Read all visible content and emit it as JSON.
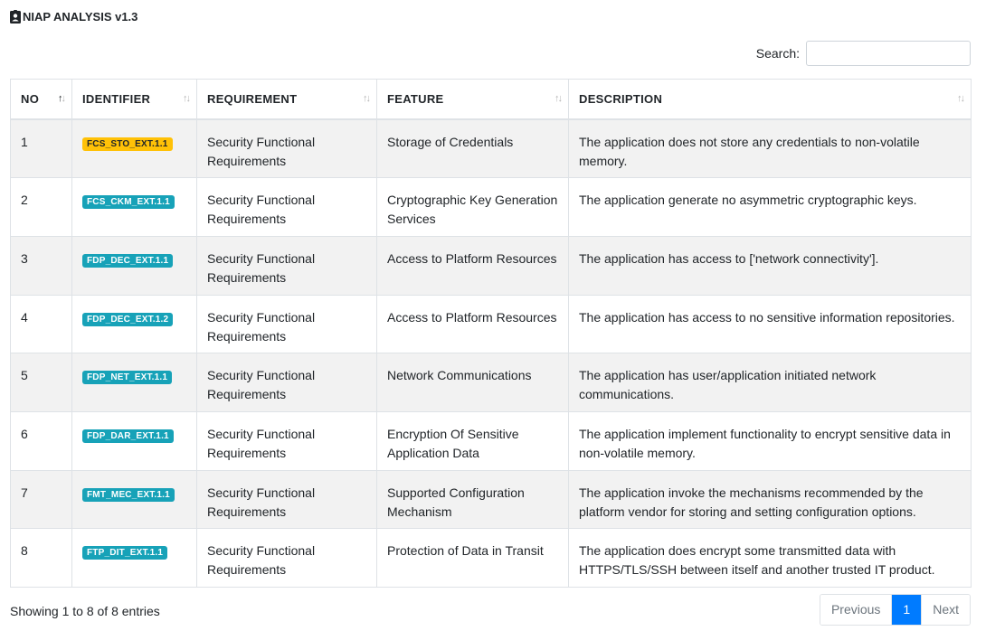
{
  "app": {
    "title": "NIAP ANALYSIS v1.3"
  },
  "search": {
    "label": "Search:",
    "value": "",
    "placeholder": ""
  },
  "table": {
    "columns": [
      "NO",
      "IDENTIFIER",
      "REQUIREMENT",
      "FEATURE",
      "DESCRIPTION"
    ],
    "sorted_column": "NO",
    "rows": [
      {
        "no": "1",
        "identifier": "FCS_STO_EXT.1.1",
        "badge": "warning",
        "requirement": "Security Functional Requirements",
        "feature": "Storage of Credentials",
        "description": "The application does not store any credentials to non-volatile memory."
      },
      {
        "no": "2",
        "identifier": "FCS_CKM_EXT.1.1",
        "badge": "info",
        "requirement": "Security Functional Requirements",
        "feature": "Cryptographic Key Generation Services",
        "description": "The application generate no asymmetric cryptographic keys."
      },
      {
        "no": "3",
        "identifier": "FDP_DEC_EXT.1.1",
        "badge": "info",
        "requirement": "Security Functional Requirements",
        "feature": "Access to Platform Resources",
        "description": "The application has access to ['network connectivity']."
      },
      {
        "no": "4",
        "identifier": "FDP_DEC_EXT.1.2",
        "badge": "info",
        "requirement": "Security Functional Requirements",
        "feature": "Access to Platform Resources",
        "description": "The application has access to no sensitive information repositories."
      },
      {
        "no": "5",
        "identifier": "FDP_NET_EXT.1.1",
        "badge": "info",
        "requirement": "Security Functional Requirements",
        "feature": "Network Communications",
        "description": "The application has user/application initiated network communications."
      },
      {
        "no": "6",
        "identifier": "FDP_DAR_EXT.1.1",
        "badge": "info",
        "requirement": "Security Functional Requirements",
        "feature": "Encryption Of Sensitive Application Data",
        "description": "The application implement functionality to encrypt sensitive data in non-volatile memory."
      },
      {
        "no": "7",
        "identifier": "FMT_MEC_EXT.1.1",
        "badge": "info",
        "requirement": "Security Functional Requirements",
        "feature": "Supported Configuration Mechanism",
        "description": "The application invoke the mechanisms recommended by the platform vendor for storing and setting configuration options."
      },
      {
        "no": "8",
        "identifier": "FTP_DIT_EXT.1.1",
        "badge": "info",
        "requirement": "Security Functional Requirements",
        "feature": "Protection of Data in Transit",
        "description": "The application does encrypt some transmitted data with HTTPS/TLS/SSH between itself and another trusted IT product."
      }
    ]
  },
  "footer": {
    "info": "Showing 1 to 8 of 8 entries",
    "previous": "Previous",
    "current_page": "1",
    "next": "Next"
  },
  "colors": {
    "badge_info": "#17a2b8",
    "badge_warning": "#ffc107",
    "page_active": "#007bff",
    "row_stripe": "#f2f2f2"
  },
  "icons": {
    "title_icon": "id-badge-icon",
    "sort": "sort-arrows-icon"
  }
}
